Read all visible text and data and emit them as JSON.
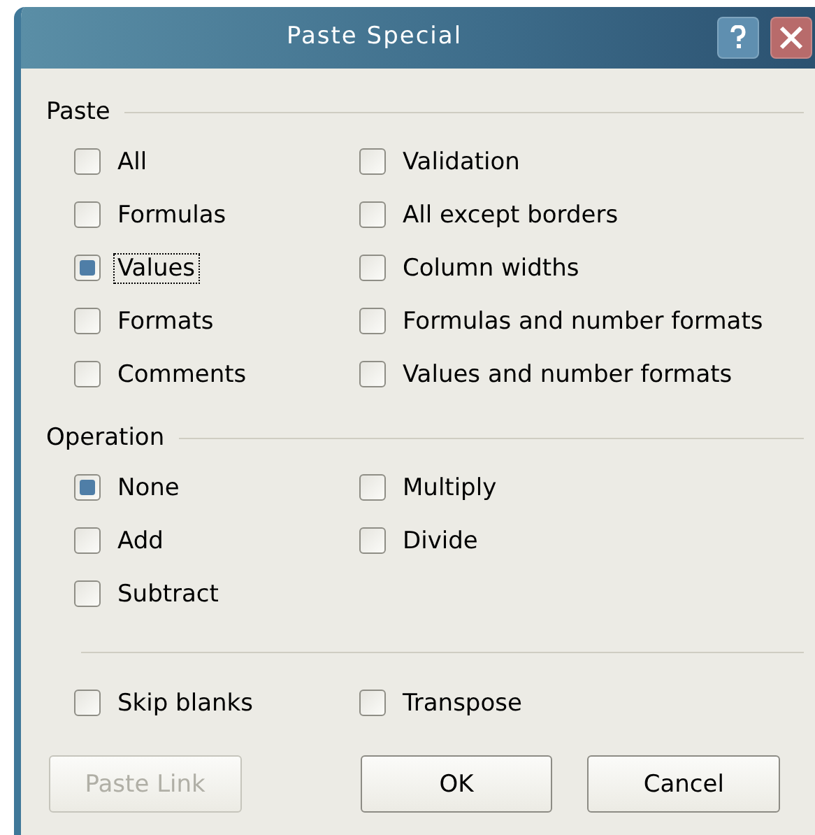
{
  "window": {
    "title": "Paste Special"
  },
  "paste": {
    "label": "Paste",
    "options": [
      {
        "label": "All",
        "selected": false,
        "focused": false
      },
      {
        "label": "Validation",
        "selected": false,
        "focused": false
      },
      {
        "label": "Formulas",
        "selected": false,
        "focused": false
      },
      {
        "label": "All except borders",
        "selected": false,
        "focused": false
      },
      {
        "label": "Values",
        "selected": true,
        "focused": true
      },
      {
        "label": "Column widths",
        "selected": false,
        "focused": false
      },
      {
        "label": "Formats",
        "selected": false,
        "focused": false
      },
      {
        "label": "Formulas and number formats",
        "selected": false,
        "focused": false
      },
      {
        "label": "Comments",
        "selected": false,
        "focused": false
      },
      {
        "label": "Values and number formats",
        "selected": false,
        "focused": false
      }
    ]
  },
  "operation": {
    "label": "Operation",
    "options": [
      {
        "label": "None",
        "selected": true
      },
      {
        "label": "Multiply",
        "selected": false
      },
      {
        "label": "Add",
        "selected": false
      },
      {
        "label": "Divide",
        "selected": false
      },
      {
        "label": "Subtract",
        "selected": false
      }
    ]
  },
  "toggles": [
    {
      "label": "Skip blanks",
      "checked": false
    },
    {
      "label": "Transpose",
      "checked": false
    }
  ],
  "buttons": [
    {
      "label": "Paste Link",
      "disabled": true
    },
    {
      "label": "OK",
      "disabled": false
    },
    {
      "label": "Cancel",
      "disabled": false
    }
  ]
}
